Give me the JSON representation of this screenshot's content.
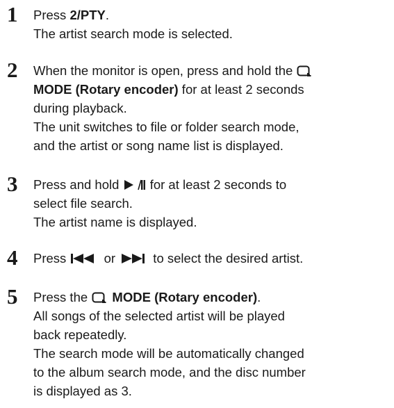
{
  "steps": [
    {
      "number": "1",
      "line1_prefix": "Press ",
      "line1_bold": "2/PTY",
      "line1_suffix": ".",
      "line2": "The artist search mode is selected."
    },
    {
      "number": "2",
      "line1_prefix": "When the monitor is open, press and hold the ",
      "line2_bold": "MODE (Rotary encoder)",
      "line2_suffix": " for at least 2 seconds",
      "line3": "during playback.",
      "line4": "The unit switches to file or folder search mode,",
      "line5": "and the artist or song name list is displayed."
    },
    {
      "number": "3",
      "line1_prefix": "Press and hold ",
      "line1_suffix": " for at least 2 seconds to",
      "line2": "select file search.",
      "line3": "The artist name is displayed."
    },
    {
      "number": "4",
      "line1_prefix": "Press ",
      "line1_middle": " or ",
      "line1_suffix": " to select the desired artist."
    },
    {
      "number": "5",
      "line1_prefix": "Press the ",
      "line1_bold": " MODE (Rotary encoder)",
      "line1_suffix": ".",
      "line2": "All songs of the selected artist will be played",
      "line3": "back repeatedly.",
      "line4": "The search mode will be automatically changed",
      "line5": "to the album search mode, and the disc number",
      "line6": "is displayed as 3."
    }
  ],
  "icons": {
    "mode": "mode-icon",
    "play_pause": "play-pause-icon",
    "previous": "previous-track-icon",
    "next": "next-track-icon"
  }
}
